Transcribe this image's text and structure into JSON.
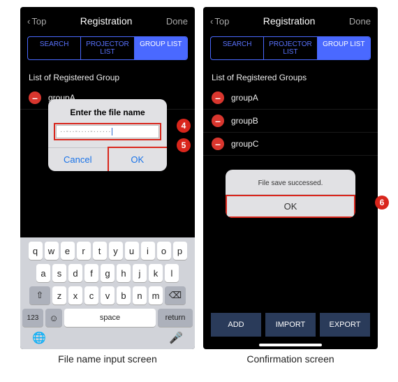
{
  "left": {
    "caption": "File name input screen",
    "header": {
      "back": "Top",
      "title": "Registration",
      "done": "Done"
    },
    "tabs": {
      "search": "SEARCH",
      "projectorList": "PROJECTOR LIST",
      "groupList": "GROUP LIST",
      "activeIndex": 2
    },
    "sectionTitle": "List of Registered Group",
    "groups": [
      "groupA"
    ],
    "dialog": {
      "title": "Enter the file name",
      "input": "··-··-····-······",
      "cancel": "Cancel",
      "ok": "OK"
    },
    "keyboard": {
      "row1": [
        "q",
        "w",
        "e",
        "r",
        "t",
        "y",
        "u",
        "i",
        "o",
        "p"
      ],
      "row2": [
        "a",
        "s",
        "d",
        "f",
        "g",
        "h",
        "j",
        "k",
        "l"
      ],
      "row3Shift": "⇧",
      "row3": [
        "z",
        "x",
        "c",
        "v",
        "b",
        "n",
        "m"
      ],
      "row3Del": "⌫",
      "row4": {
        "num": "123",
        "emoji": "☺",
        "space": "space",
        "return": "return"
      },
      "row5": {
        "globe": "🌐",
        "mic": "🎤"
      }
    },
    "callouts": {
      "c4": "4",
      "c5": "5"
    }
  },
  "right": {
    "caption": "Confirmation screen",
    "header": {
      "back": "Top",
      "title": "Registration",
      "done": "Done"
    },
    "tabs": {
      "search": "SEARCH",
      "projectorList": "PROJECTOR LIST",
      "groupList": "GROUP LIST",
      "activeIndex": 2
    },
    "sectionTitle": "List of Registered Groups",
    "groups": [
      "groupA",
      "groupB",
      "groupC"
    ],
    "dialog": {
      "msg": "File save successed.",
      "ok": "OK"
    },
    "bottomBtns": {
      "add": "ADD",
      "import": "IMPORT",
      "export": "EXPORT"
    },
    "callouts": {
      "c6": "6"
    }
  }
}
